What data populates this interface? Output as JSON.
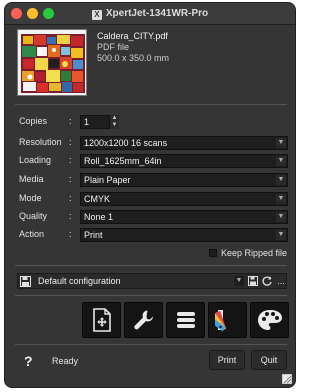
{
  "window": {
    "title": "XpertJet-1341WR-Pro"
  },
  "file": {
    "name": "Caldera_CITY.pdf",
    "type": "PDF file",
    "size": "500.0 x 350.0 mm"
  },
  "settings": {
    "copies": {
      "label": "Copies",
      "value": "1"
    },
    "resolution": {
      "label": "Resolution",
      "value": "1200x1200 16 scans"
    },
    "loading": {
      "label": "Loading",
      "value": "Roll_1625mm_64in"
    },
    "media": {
      "label": "Media",
      "value": "Plain Paper"
    },
    "mode": {
      "label": "Mode",
      "value": "CMYK"
    },
    "quality": {
      "label": "Quality",
      "value": "None 1"
    },
    "action": {
      "label": "Action",
      "value": "Print"
    },
    "colon": ":"
  },
  "keep_ripped": {
    "label": "Keep Ripped file",
    "checked": false
  },
  "configuration": {
    "value": "Default configuration",
    "more_label": "..."
  },
  "tools": [
    {
      "icon": "add-page-icon"
    },
    {
      "icon": "wrench-icon"
    },
    {
      "icon": "list-icon"
    },
    {
      "icon": "color-swatch-icon"
    },
    {
      "icon": "palette-icon"
    }
  ],
  "footer": {
    "help": "?",
    "status": "Ready",
    "print_label": "Print",
    "quit_label": "Quit"
  },
  "colors": {
    "background": "#353535",
    "field": "#1e1e1e",
    "tool_button": "#141414"
  }
}
